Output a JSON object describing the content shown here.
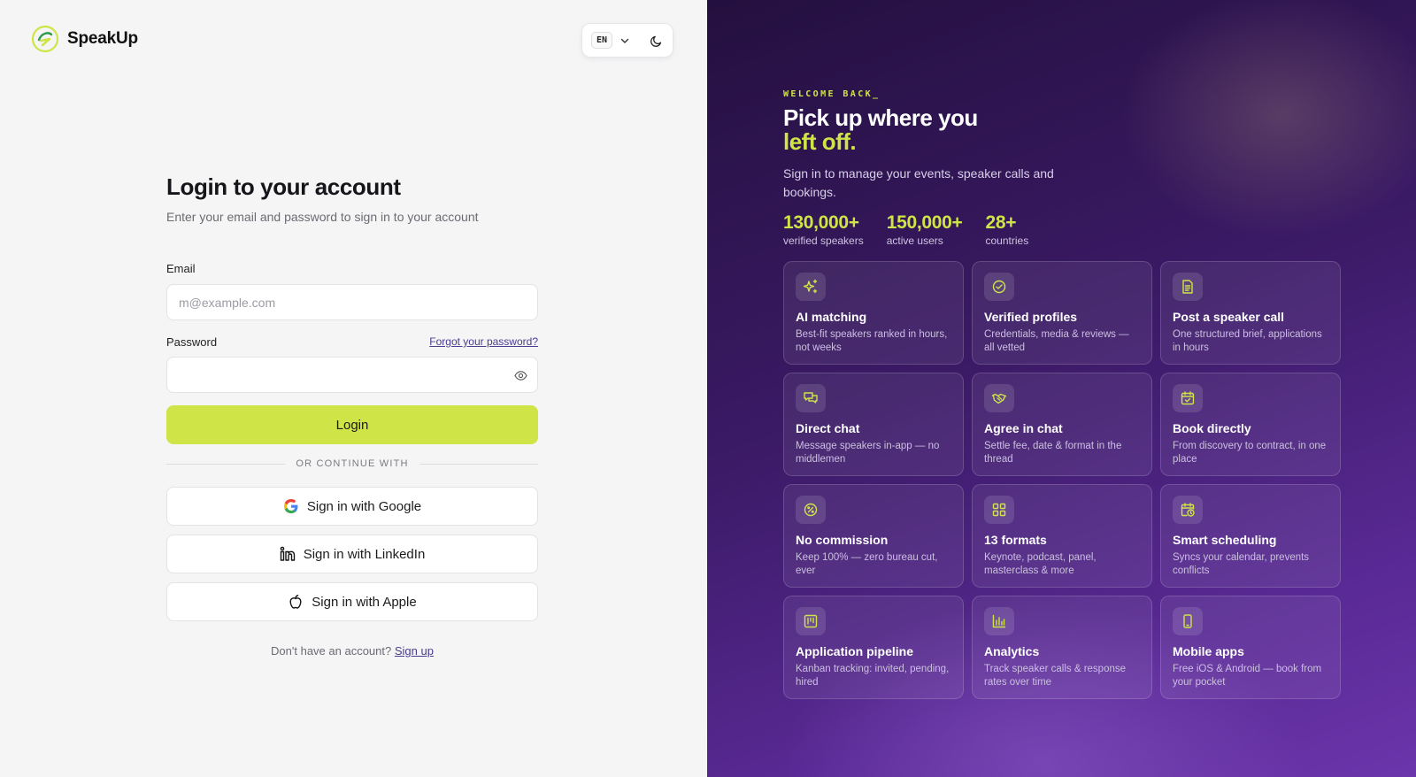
{
  "brand": {
    "name": "SpeakUp",
    "accent": "#cfe447",
    "purple": "#3b1a66"
  },
  "toolbar": {
    "language": "EN"
  },
  "login": {
    "title": "Login to your account",
    "subtitle": "Enter your email and password to sign in to your account",
    "email_label": "Email",
    "email_placeholder": "m@example.com",
    "password_label": "Password",
    "forgot_label": "Forgot your password?",
    "login_button": "Login",
    "divider": "OR CONTINUE WITH",
    "google": "Sign in with Google",
    "linkedin": "Sign in with LinkedIn",
    "apple": "Sign in with Apple",
    "no_account": "Don't have an account?",
    "signup": "Sign up"
  },
  "promo": {
    "eyebrow": "WELCOME BACK_",
    "headline_1": "Pick up where you",
    "headline_2": "left off.",
    "description": "Sign in to manage your events, speaker calls and bookings.",
    "stats": [
      {
        "value": "130,000+",
        "label": "verified speakers"
      },
      {
        "value": "150,000+",
        "label": "active users"
      },
      {
        "value": "28+",
        "label": "countries"
      }
    ],
    "features": [
      {
        "icon": "sparkles-icon",
        "title": "AI matching",
        "desc": "Best-fit speakers ranked in hours, not weeks"
      },
      {
        "icon": "badge-check-icon",
        "title": "Verified profiles",
        "desc": "Credentials, media & reviews — all vetted"
      },
      {
        "icon": "document-icon",
        "title": "Post a speaker call",
        "desc": "One structured brief, applications in hours"
      },
      {
        "icon": "chat-icon",
        "title": "Direct chat",
        "desc": "Message speakers in-app — no middlemen"
      },
      {
        "icon": "handshake-icon",
        "title": "Agree in chat",
        "desc": "Settle fee, date & format in the thread"
      },
      {
        "icon": "calendar-check-icon",
        "title": "Book directly",
        "desc": "From discovery to contract, in one place"
      },
      {
        "icon": "percent-badge-icon",
        "title": "No commission",
        "desc": "Keep 100% — zero bureau cut, ever"
      },
      {
        "icon": "grid-icon",
        "title": "13 formats",
        "desc": "Keynote, podcast, panel, masterclass & more"
      },
      {
        "icon": "calendar-clock-icon",
        "title": "Smart scheduling",
        "desc": "Syncs your calendar, prevents conflicts"
      },
      {
        "icon": "kanban-icon",
        "title": "Application pipeline",
        "desc": "Kanban tracking: invited, pending, hired"
      },
      {
        "icon": "bar-chart-icon",
        "title": "Analytics",
        "desc": "Track speaker calls & response rates over time"
      },
      {
        "icon": "smartphone-icon",
        "title": "Mobile apps",
        "desc": "Free iOS & Android — book from your pocket"
      }
    ]
  }
}
